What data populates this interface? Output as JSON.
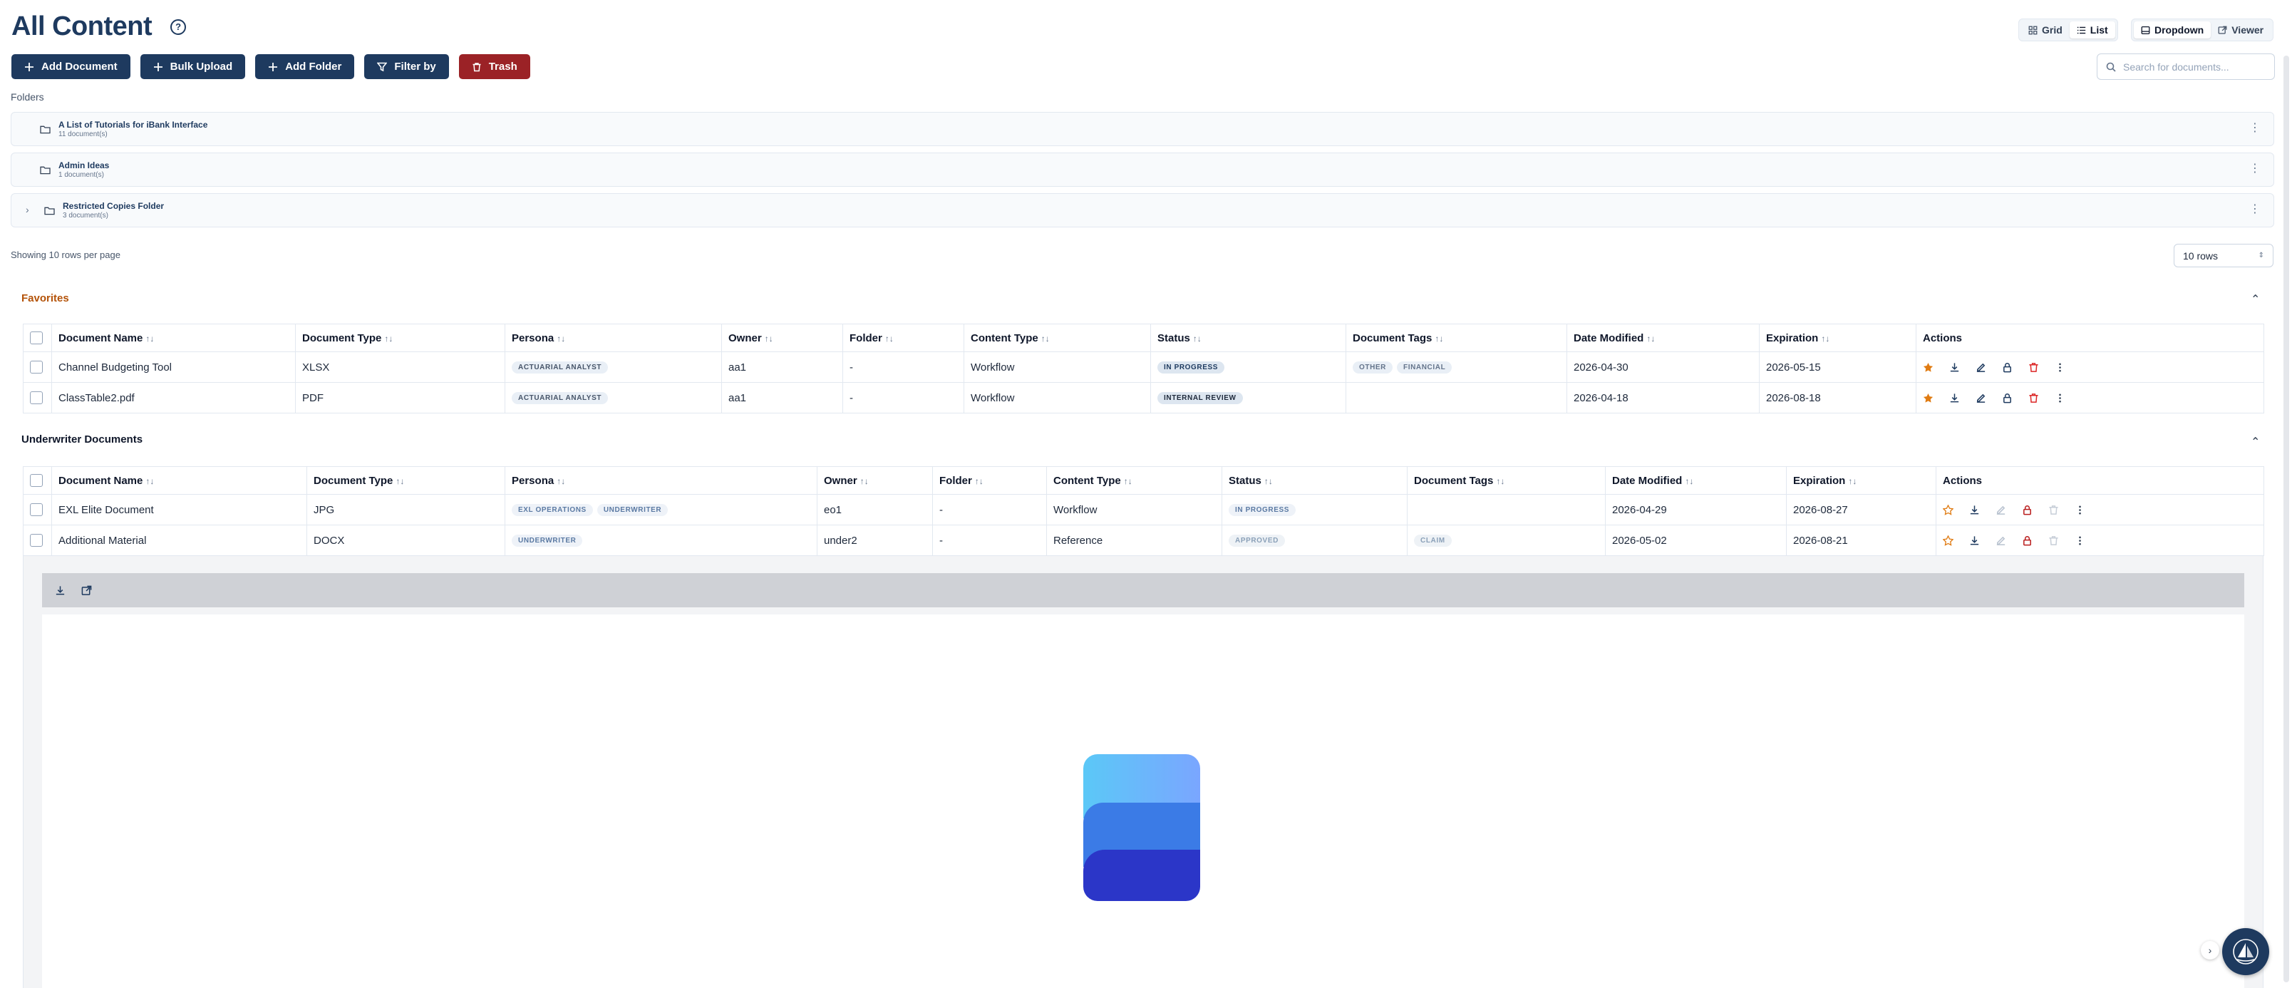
{
  "header": {
    "title": "All Content",
    "help_glyph": "?"
  },
  "view_layout": {
    "grid": "Grid",
    "list": "List"
  },
  "view_mode": {
    "dropdown": "Dropdown",
    "viewer": "Viewer"
  },
  "toolbar": {
    "add_document": "Add Document",
    "bulk_upload": "Bulk Upload",
    "add_folder": "Add Folder",
    "filter_by": "Filter by",
    "trash": "Trash"
  },
  "search": {
    "placeholder": "Search for documents..."
  },
  "folders": {
    "label": "Folders",
    "items": [
      {
        "name": "A List of Tutorials for iBank Interface",
        "count": "11 document(s)"
      },
      {
        "name": "Admin Ideas",
        "count": "1 document(s)"
      },
      {
        "name": "Restricted Copies Folder",
        "count": "3 document(s)"
      }
    ]
  },
  "pagination": {
    "info": "Showing 10 rows per page",
    "rows_value": "10 rows"
  },
  "sort_glyph": "↑↓",
  "columns": [
    "Document Name",
    "Document Type",
    "Persona",
    "Owner",
    "Folder",
    "Content Type",
    "Status",
    "Document Tags",
    "Date Modified",
    "Expiration",
    "Actions"
  ],
  "favorites": {
    "title": "Favorites",
    "rows": [
      {
        "name": "Channel Budgeting Tool",
        "type": "XLSX",
        "persona": [
          "ACTUARIAL ANALYST"
        ],
        "owner": "aa1",
        "folder": "-",
        "content_type": "Workflow",
        "status": "IN PROGRESS",
        "tags": [
          "OTHER",
          "FINANCIAL"
        ],
        "modified": "2026-04-30",
        "expiration": "2026-05-15"
      },
      {
        "name": "ClassTable2.pdf",
        "type": "PDF",
        "persona": [
          "ACTUARIAL ANALYST"
        ],
        "owner": "aa1",
        "folder": "-",
        "content_type": "Workflow",
        "status": "INTERNAL REVIEW",
        "tags": [],
        "modified": "2026-04-18",
        "expiration": "2026-08-18"
      }
    ]
  },
  "underwriter": {
    "title": "Underwriter Documents",
    "rows": [
      {
        "name": "EXL Elite Document",
        "type": "JPG",
        "persona": [
          "EXL OPERATIONS",
          "UNDERWRITER"
        ],
        "owner": "eo1",
        "folder": "-",
        "content_type": "Workflow",
        "status": "IN PROGRESS",
        "tags": [],
        "modified": "2026-04-29",
        "expiration": "2026-08-27"
      },
      {
        "name": "Additional Material",
        "type": "DOCX",
        "persona": [
          "UNDERWRITER"
        ],
        "owner": "under2",
        "folder": "-",
        "content_type": "Reference",
        "status": "APPROVED",
        "tags": [
          "CLAIM"
        ],
        "modified": "2026-05-02",
        "expiration": "2026-08-21"
      }
    ]
  },
  "menu_glyph": "⋮",
  "colors": {
    "navy": "#1e3a5f",
    "danger": "#9b2226",
    "favorites_title": "#b45309",
    "star": "#e07b12",
    "delete": "#dc2626"
  }
}
